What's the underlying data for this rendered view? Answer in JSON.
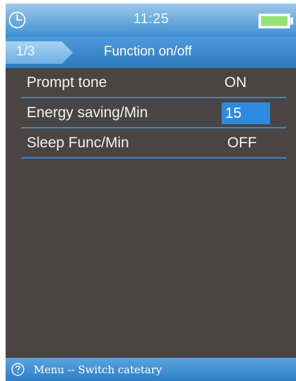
{
  "status_bar": {
    "time": "11:25",
    "clock_icon": "clock-icon",
    "battery_icon": "battery-icon",
    "battery_level": 1.0
  },
  "title_bar": {
    "page_indicator": "1/3",
    "title": "Function on/off"
  },
  "menu": {
    "items": [
      {
        "label": "Prompt tone",
        "value": "ON",
        "selected": false
      },
      {
        "label": "Energy saving/Min",
        "value": "15",
        "selected": true
      },
      {
        "label": "Sleep Func/Min",
        "value": "OFF",
        "selected": false
      }
    ]
  },
  "bottom_bar": {
    "help_icon": "help-circle-icon",
    "text": "Menu -- Switch catetary"
  },
  "colors": {
    "background": "#4a4542",
    "accent": "#2f8ae0",
    "divider": "#3a86cf",
    "battery": "#9be07a"
  }
}
